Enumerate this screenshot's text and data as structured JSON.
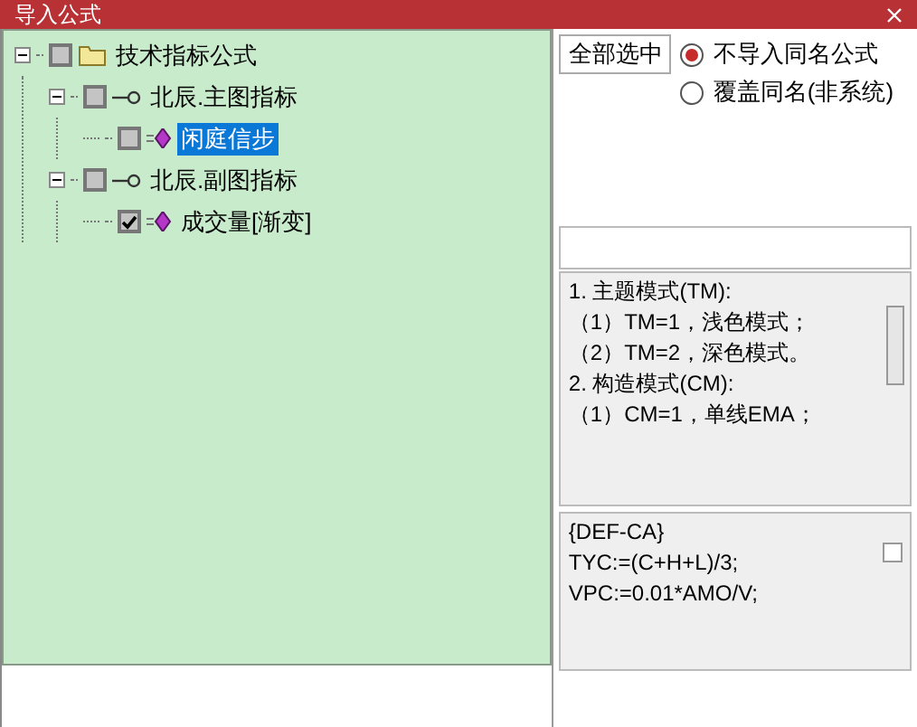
{
  "window": {
    "title": "导入公式"
  },
  "tree": [
    {
      "label": "技术指标公式",
      "kind": "folder",
      "expanded": true,
      "checked": false,
      "selected": false,
      "children": [
        {
          "label": "北辰.主图指标",
          "kind": "group",
          "expanded": true,
          "checked": false,
          "selected": false,
          "children": [
            {
              "label": "闲庭信步",
              "kind": "formula",
              "checked": false,
              "selected": true
            }
          ]
        },
        {
          "label": "北辰.副图指标",
          "kind": "group",
          "expanded": true,
          "checked": false,
          "selected": false,
          "children": [
            {
              "label": "成交量[渐变]",
              "kind": "formula",
              "checked": true,
              "selected": false
            }
          ]
        }
      ]
    }
  ],
  "select_all_button": "全部选中",
  "options": [
    {
      "label": "不导入同名公式",
      "selected": true
    },
    {
      "label": "覆盖同名(非系统)",
      "selected": false
    }
  ],
  "description": [
    "1. 主题模式(TM):",
    "（1）TM=1，浅色模式；",
    "（2）TM=2，深色模式。",
    "2. 构造模式(CM):",
    "（1）CM=1，单线EMA；"
  ],
  "code": {
    "lines": [
      "{DEF-CA}",
      "TYC:=(C+H+L)/3;",
      "VPC:=0.01*AMO/V;"
    ],
    "checked": false
  }
}
